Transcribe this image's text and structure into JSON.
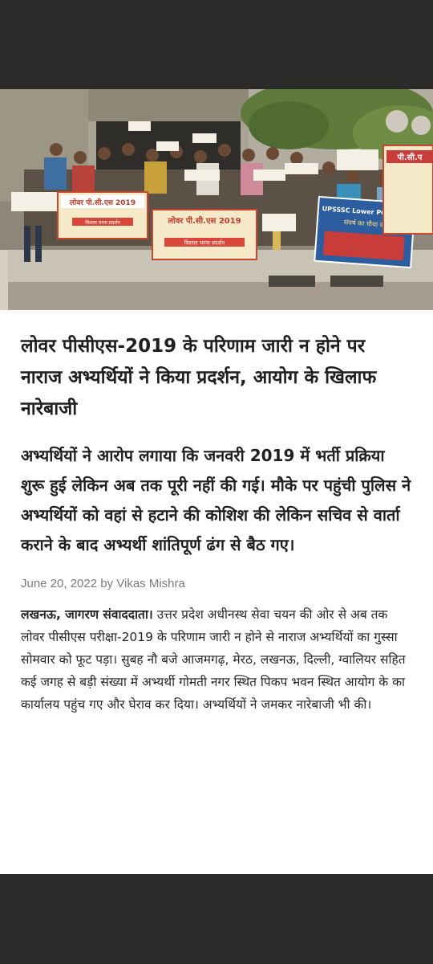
{
  "photo": {
    "alt": "",
    "banner_left": "लोवर पी.सी.एस 2019",
    "banner_left_sub": "विशाल धरना प्रदर्शन",
    "banner_center": "लोवर पी.सी.एस 2019",
    "banner_center_sub": "विशाल धरना प्रदर्शन",
    "banner_right_title": "UPSSSC Lower PCS 2019",
    "banner_right_sub": "संघर्ष का चौथा वर्ष",
    "banner_far_right": "पी.सी.प"
  },
  "article": {
    "headline": "लोवर पीसीएस-2019 के परिणाम जारी न होने पर नाराज अभ्यर्थियों ने किया प्रदर्शन, आयोग के खिलाफ नारेबाजी",
    "summary": "अभ्यर्थियों ने आरोप लगाया कि जनवरी 2019 में भर्ती प्रक्रिया शुरू हुई लेकिन अब तक पूरी नहीं की गई। मौके पर पहुंची पुलिस ने अभ्यर्थियों को वहां से हटाने की कोशिश की लेकिन सचिव से वार्ता कराने के बाद अभ्यर्थी शांतिपूर्ण ढंग से बैठ गए।",
    "byline": "June 20, 2022 by Vikas Mishra",
    "dateline": "लखनऊ, जागरण संवाददाता।",
    "body": " उत्तर प्रदेश अधीनस्थ सेवा चयन की ओर से अब तक लोवर पीसीएस परीक्षा-2019 के परिणाम जारी न होने से नाराज अभ्यर्थियों का गुस्सा सोमवार को फूट पड़ा। सुबह नौ बजे आजमगढ़, मेरठ, लखनऊ, दिल्ली, ग्वालियर सहित कई जगह से बड़ी संख्या में अभ्यर्थी गोमती नगर स्थित पिकप भवन स्थित आयोग के का कार्यालय पहुंच गए और घेराव कर दिया। अभ्यर्थियों ने जमकर नारेबाजी भी की।"
  }
}
